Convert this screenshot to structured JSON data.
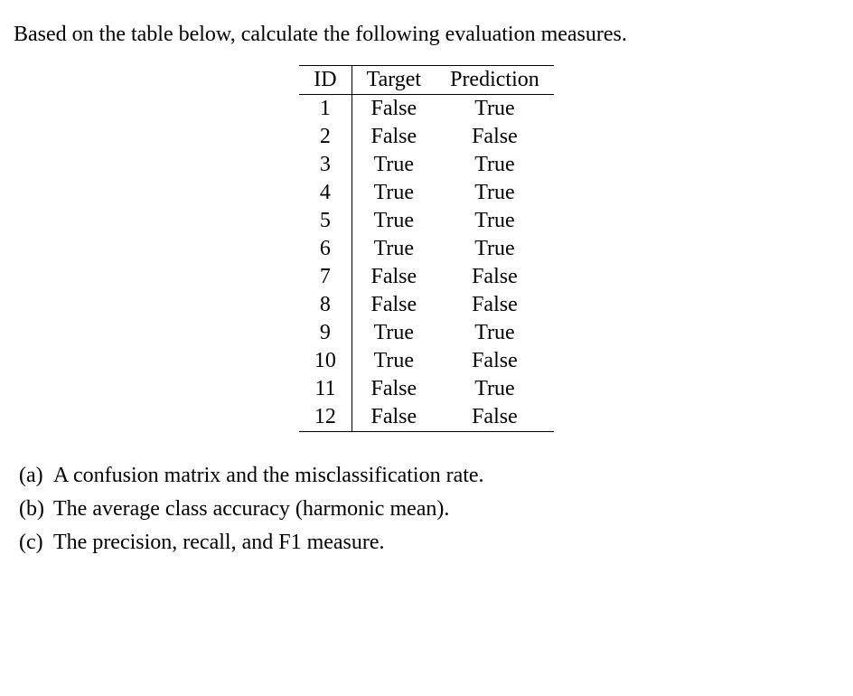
{
  "intro": "Based on the table below, calculate the following evaluation measures.",
  "headers": {
    "id": "ID",
    "target": "Target",
    "prediction": "Prediction"
  },
  "chart_data": {
    "type": "table",
    "columns": [
      "ID",
      "Target",
      "Prediction"
    ],
    "rows": [
      {
        "id": "1",
        "target": "False",
        "prediction": "True"
      },
      {
        "id": "2",
        "target": "False",
        "prediction": "False"
      },
      {
        "id": "3",
        "target": "True",
        "prediction": "True"
      },
      {
        "id": "4",
        "target": "True",
        "prediction": "True"
      },
      {
        "id": "5",
        "target": "True",
        "prediction": "True"
      },
      {
        "id": "6",
        "target": "True",
        "prediction": "True"
      },
      {
        "id": "7",
        "target": "False",
        "prediction": "False"
      },
      {
        "id": "8",
        "target": "False",
        "prediction": "False"
      },
      {
        "id": "9",
        "target": "True",
        "prediction": "True"
      },
      {
        "id": "10",
        "target": "True",
        "prediction": "False"
      },
      {
        "id": "11",
        "target": "False",
        "prediction": "True"
      },
      {
        "id": "12",
        "target": "False",
        "prediction": "False"
      }
    ]
  },
  "questions": [
    {
      "label": "(a)",
      "text": "A confusion matrix and the misclassification rate."
    },
    {
      "label": "(b)",
      "text": "The average class accuracy (harmonic mean)."
    },
    {
      "label": "(c)",
      "text": "The precision, recall, and F1 measure."
    }
  ]
}
